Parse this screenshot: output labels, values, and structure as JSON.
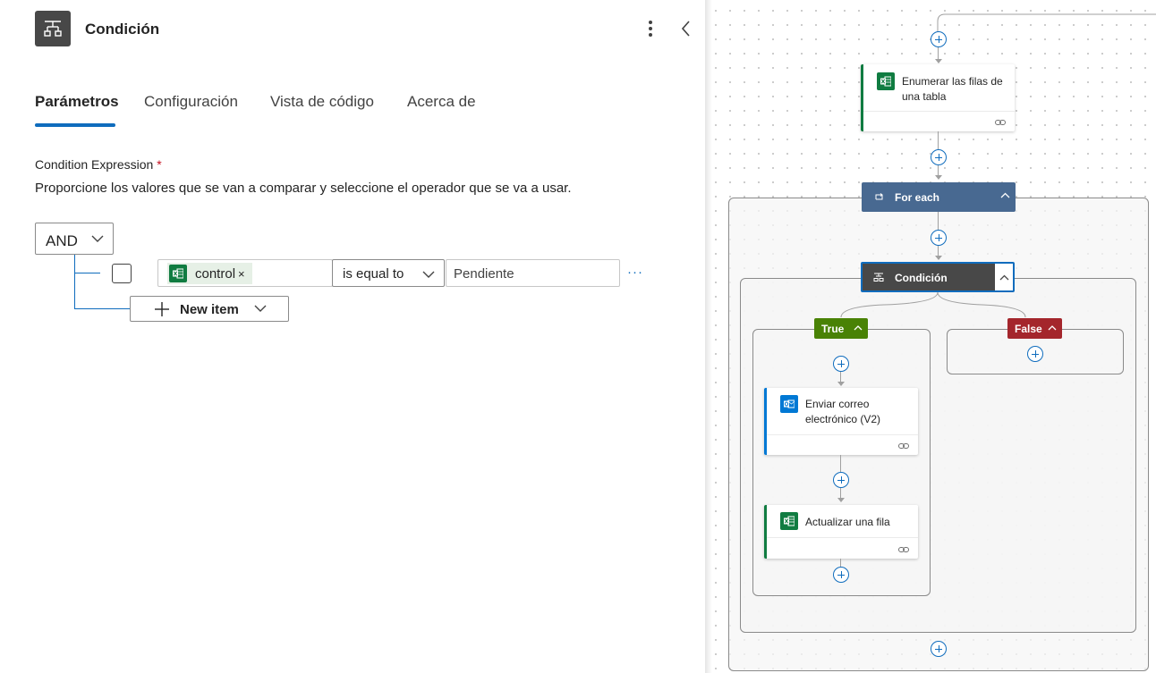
{
  "panel": {
    "title": "Condición",
    "header_icon": "condition-icon",
    "more_icon": "more-vertical-icon",
    "collapse_icon": "chevron-left-icon"
  },
  "tabs": [
    {
      "label": "Parámetros",
      "active": true
    },
    {
      "label": "Configuración",
      "active": false
    },
    {
      "label": "Vista de código",
      "active": false
    },
    {
      "label": "Acerca de",
      "active": false
    }
  ],
  "condition": {
    "label": "Condition Expression",
    "required_mark": "*",
    "description": "Proporcione los valores que se van a comparar y seleccione el operador que se va a usar.",
    "group_operator": "AND",
    "row": {
      "left_token": "control",
      "token_remove": "×",
      "operator": "is equal to",
      "right_value": "Pendiente",
      "more": "···"
    },
    "new_item_label": "New item"
  },
  "flow": {
    "list_rows_card": {
      "title_line1": "Enumerar las filas de",
      "title_line2": "una tabla",
      "icon": "excel-icon"
    },
    "for_each": {
      "title": "For each",
      "icon": "loop-icon"
    },
    "condition_node": {
      "title": "Condición",
      "icon": "condition-icon"
    },
    "true_branch": {
      "label": "True"
    },
    "false_branch": {
      "label": "False"
    },
    "send_email_card": {
      "title_line1": "Enviar correo",
      "title_line2": "electrónico (V2)",
      "icon": "outlook-icon"
    },
    "update_row_card": {
      "title": "Actualizar una fila",
      "icon": "excel-icon"
    }
  },
  "colors": {
    "accent_blue": "#0f6cbd",
    "excel_green": "#107c41",
    "outlook_blue": "#0078d4",
    "foreach_blue": "#486991",
    "condition_dark": "#484848",
    "true_green": "#498205",
    "false_red": "#a4262c"
  }
}
